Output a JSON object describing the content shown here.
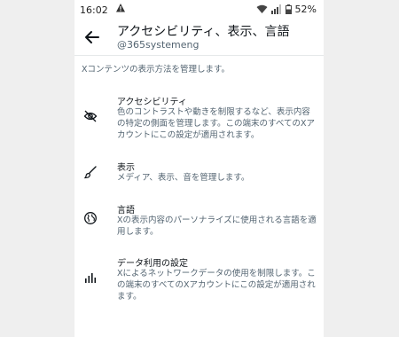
{
  "status_bar": {
    "time": "16:02",
    "battery": "52%"
  },
  "header": {
    "title": "アクセシビリティ、表示、言語",
    "handle": "@365systemeng",
    "back_icon": "arrow-left-icon"
  },
  "description": "Xコンテンツの表示方法を管理します。",
  "items": [
    {
      "label": "アクセシビリティ",
      "sub": "色のコントラストや動きを制限するなど、表示内容の特定の側面を管理します。この端末のすべてのXアカウントにこの設定が適用されます。",
      "icon": "eye-slash-icon"
    },
    {
      "label": "表示",
      "sub": "メディア、表示、音を管理します。",
      "icon": "paintbrush-icon"
    },
    {
      "label": "言語",
      "sub": "Xの表示内容のパーソナライズに使用される言語を適用します。",
      "icon": "globe-icon"
    },
    {
      "label": "データ利用の設定",
      "sub": "Xによるネットワークデータの使用を制限します。この端末のすべてのXアカウントにこの設定が適用されます。",
      "icon": "bar-chart-icon"
    }
  ],
  "colors": {
    "primary_text": "#0f1419",
    "secondary_text": "#536471",
    "background": "#ffffff"
  }
}
